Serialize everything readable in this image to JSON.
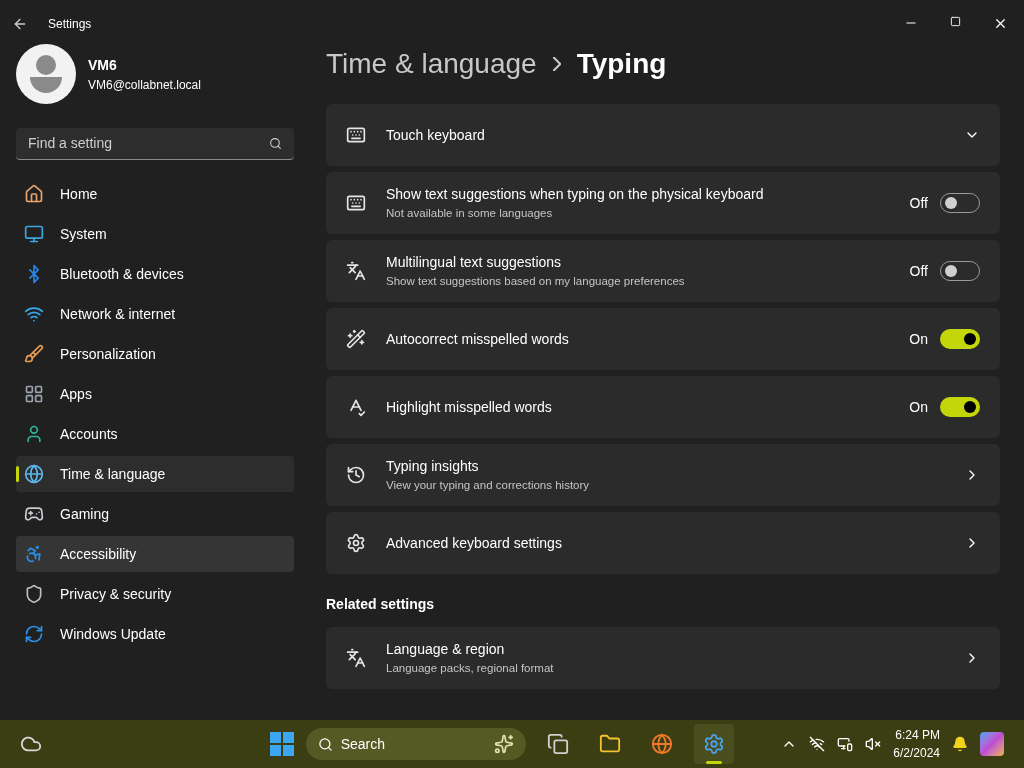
{
  "window": {
    "title": "Settings"
  },
  "account": {
    "name": "VM6",
    "email": "VM6@collabnet.local"
  },
  "search": {
    "placeholder": "Find a setting"
  },
  "nav": [
    {
      "label": "Home",
      "selected": false,
      "hovered": false
    },
    {
      "label": "System",
      "selected": false,
      "hovered": false
    },
    {
      "label": "Bluetooth & devices",
      "selected": false,
      "hovered": false
    },
    {
      "label": "Network & internet",
      "selected": false,
      "hovered": false
    },
    {
      "label": "Personalization",
      "selected": false,
      "hovered": false
    },
    {
      "label": "Apps",
      "selected": false,
      "hovered": false
    },
    {
      "label": "Accounts",
      "selected": false,
      "hovered": false
    },
    {
      "label": "Time & language",
      "selected": true,
      "hovered": false
    },
    {
      "label": "Gaming",
      "selected": false,
      "hovered": false
    },
    {
      "label": "Accessibility",
      "selected": false,
      "hovered": true
    },
    {
      "label": "Privacy & security",
      "selected": false,
      "hovered": false
    },
    {
      "label": "Windows Update",
      "selected": false,
      "hovered": false
    }
  ],
  "breadcrumb": {
    "parent": "Time & language",
    "current": "Typing"
  },
  "settings": [
    {
      "kind": "expander",
      "title": "Touch keyboard",
      "expanded": false
    },
    {
      "kind": "toggle",
      "title": "Show text suggestions when typing on the physical keyboard",
      "description": "Not available in some languages",
      "on": false,
      "state_label": "Off"
    },
    {
      "kind": "toggle",
      "title": "Multilingual text suggestions",
      "description": "Show text suggestions based on my language preferences",
      "on": false,
      "state_label": "Off"
    },
    {
      "kind": "toggle",
      "title": "Autocorrect misspelled words",
      "on": true,
      "state_label": "On"
    },
    {
      "kind": "toggle",
      "title": "Highlight misspelled words",
      "on": true,
      "state_label": "On"
    },
    {
      "kind": "link",
      "title": "Typing insights",
      "description": "View your typing and corrections history"
    },
    {
      "kind": "link",
      "title": "Advanced keyboard settings"
    }
  ],
  "related": {
    "heading": "Related settings",
    "items": [
      {
        "title": "Language & region",
        "description": "Language packs, regional format"
      }
    ]
  },
  "taskbar": {
    "search_placeholder": "Search",
    "apps": [
      {
        "selected": false
      },
      {
        "selected": false
      },
      {
        "selected": false
      },
      {
        "selected": true
      }
    ],
    "time": "6:24 PM",
    "date": "6/2/2024"
  }
}
